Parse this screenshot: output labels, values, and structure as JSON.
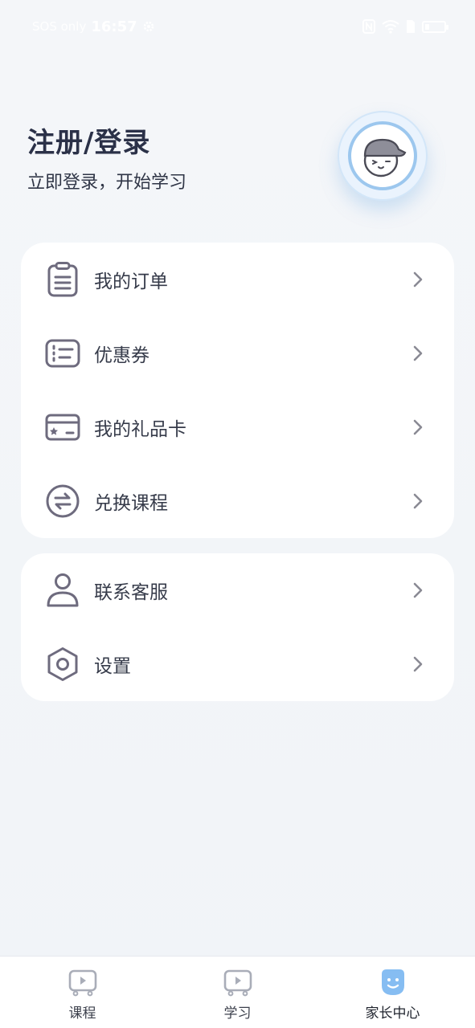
{
  "status_bar": {
    "carrier": "SOS only",
    "time": "16:57"
  },
  "header": {
    "title": "注册/登录",
    "subtitle": "立即登录，开始学习"
  },
  "menu_primary": [
    {
      "label": "我的订单",
      "icon": "clipboard-icon"
    },
    {
      "label": "优惠券",
      "icon": "coupon-icon"
    },
    {
      "label": "我的礼品卡",
      "icon": "gift-card-icon"
    },
    {
      "label": "兑换课程",
      "icon": "exchange-icon"
    }
  ],
  "menu_secondary": [
    {
      "label": "联系客服",
      "icon": "person-icon"
    },
    {
      "label": "设置",
      "icon": "settings-hexagon-icon"
    }
  ],
  "bottom_nav": [
    {
      "label": "课程",
      "icon": "tv-play-icon",
      "active": false
    },
    {
      "label": "学习",
      "icon": "tv-play-icon",
      "active": false
    },
    {
      "label": "家长中心",
      "icon": "smiley-face-icon",
      "active": true
    }
  ],
  "colors": {
    "background": "#f3f5f9",
    "card": "#ffffff",
    "icon_gray": "#6e6b7e",
    "accent_blue": "#8cc0f0",
    "title_dark": "#2b3148"
  }
}
